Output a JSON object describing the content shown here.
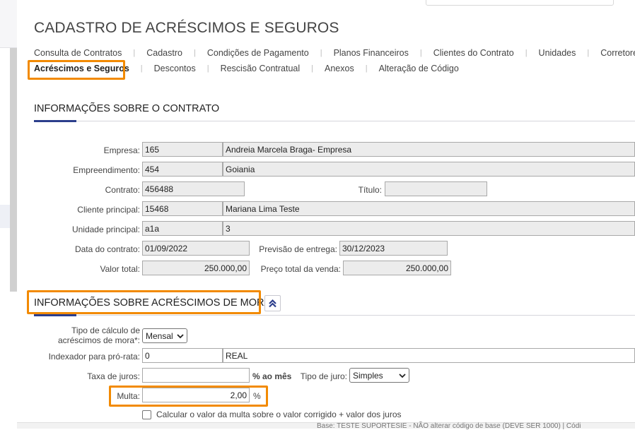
{
  "page": {
    "title": "CADASTRO DE ACRÉSCIMOS E SEGUROS"
  },
  "tabs": {
    "row1": [
      {
        "label": "Consulta de Contratos"
      },
      {
        "label": "Cadastro"
      },
      {
        "label": "Condições de Pagamento"
      },
      {
        "label": "Planos Financeiros"
      },
      {
        "label": "Clientes do Contrato"
      },
      {
        "label": "Unidades"
      },
      {
        "label": "Corretores"
      }
    ],
    "row2": [
      {
        "label": "Acréscimos e Seguros",
        "active": true
      },
      {
        "label": "Descontos"
      },
      {
        "label": "Rescisão Contratual"
      },
      {
        "label": "Anexos"
      },
      {
        "label": "Alteração de Código"
      }
    ]
  },
  "contrato": {
    "section_title": "INFORMAÇÕES SOBRE O CONTRATO",
    "empresa_label": "Empresa:",
    "empresa_code": "165",
    "empresa_name": "Andreia Marcela Braga- Empresa",
    "empreendimento_label": "Empreendimento:",
    "empreendimento_code": "454",
    "empreendimento_name": "Goiania",
    "contrato_label": "Contrato:",
    "contrato_value": "456488",
    "titulo_label": "Título:",
    "titulo_value": "",
    "cliente_label": "Cliente principal:",
    "cliente_code": "15468",
    "cliente_name": "Mariana Lima Teste",
    "unidade_label": "Unidade principal:",
    "unidade_code": "a1a",
    "unidade_name": "3",
    "data_label": "Data do contrato:",
    "data_value": "01/09/2022",
    "previsao_label": "Previsão de entrega:",
    "previsao_value": "30/12/2023",
    "valor_label": "Valor total:",
    "valor_value": "250.000,00",
    "preco_label": "Preço total da venda:",
    "preco_value": "250.000,00"
  },
  "mora": {
    "section_title": "INFORMAÇÕES SOBRE ACRÉSCIMOS DE MORA",
    "tipo_label_line1": "Tipo de cálculo de",
    "tipo_label_line2": "acréscimos de mora*:",
    "tipo_value": "Mensal",
    "indexador_label": "Indexador para pró-rata:",
    "indexador_code": "0",
    "indexador_name": "REAL",
    "taxa_label": "Taxa de juros:",
    "taxa_value": "",
    "taxa_unit": "% ao mês",
    "tipo_juro_label": "Tipo de juro:",
    "tipo_juro_value": "Simples",
    "multa_label": "Multa:",
    "multa_value": "2,00",
    "multa_unit": "%",
    "checkbox_label": "Calcular o valor da multa sobre o valor corrigido + valor dos juros",
    "checkbox_checked": false
  },
  "footer": {
    "text": "Base: TESTE SUPORTESIE - NÃO alterar código de base (DEVE SER 1000) | Códi"
  },
  "colors": {
    "highlight": "#f28a00",
    "accent": "#2c3e8c"
  }
}
